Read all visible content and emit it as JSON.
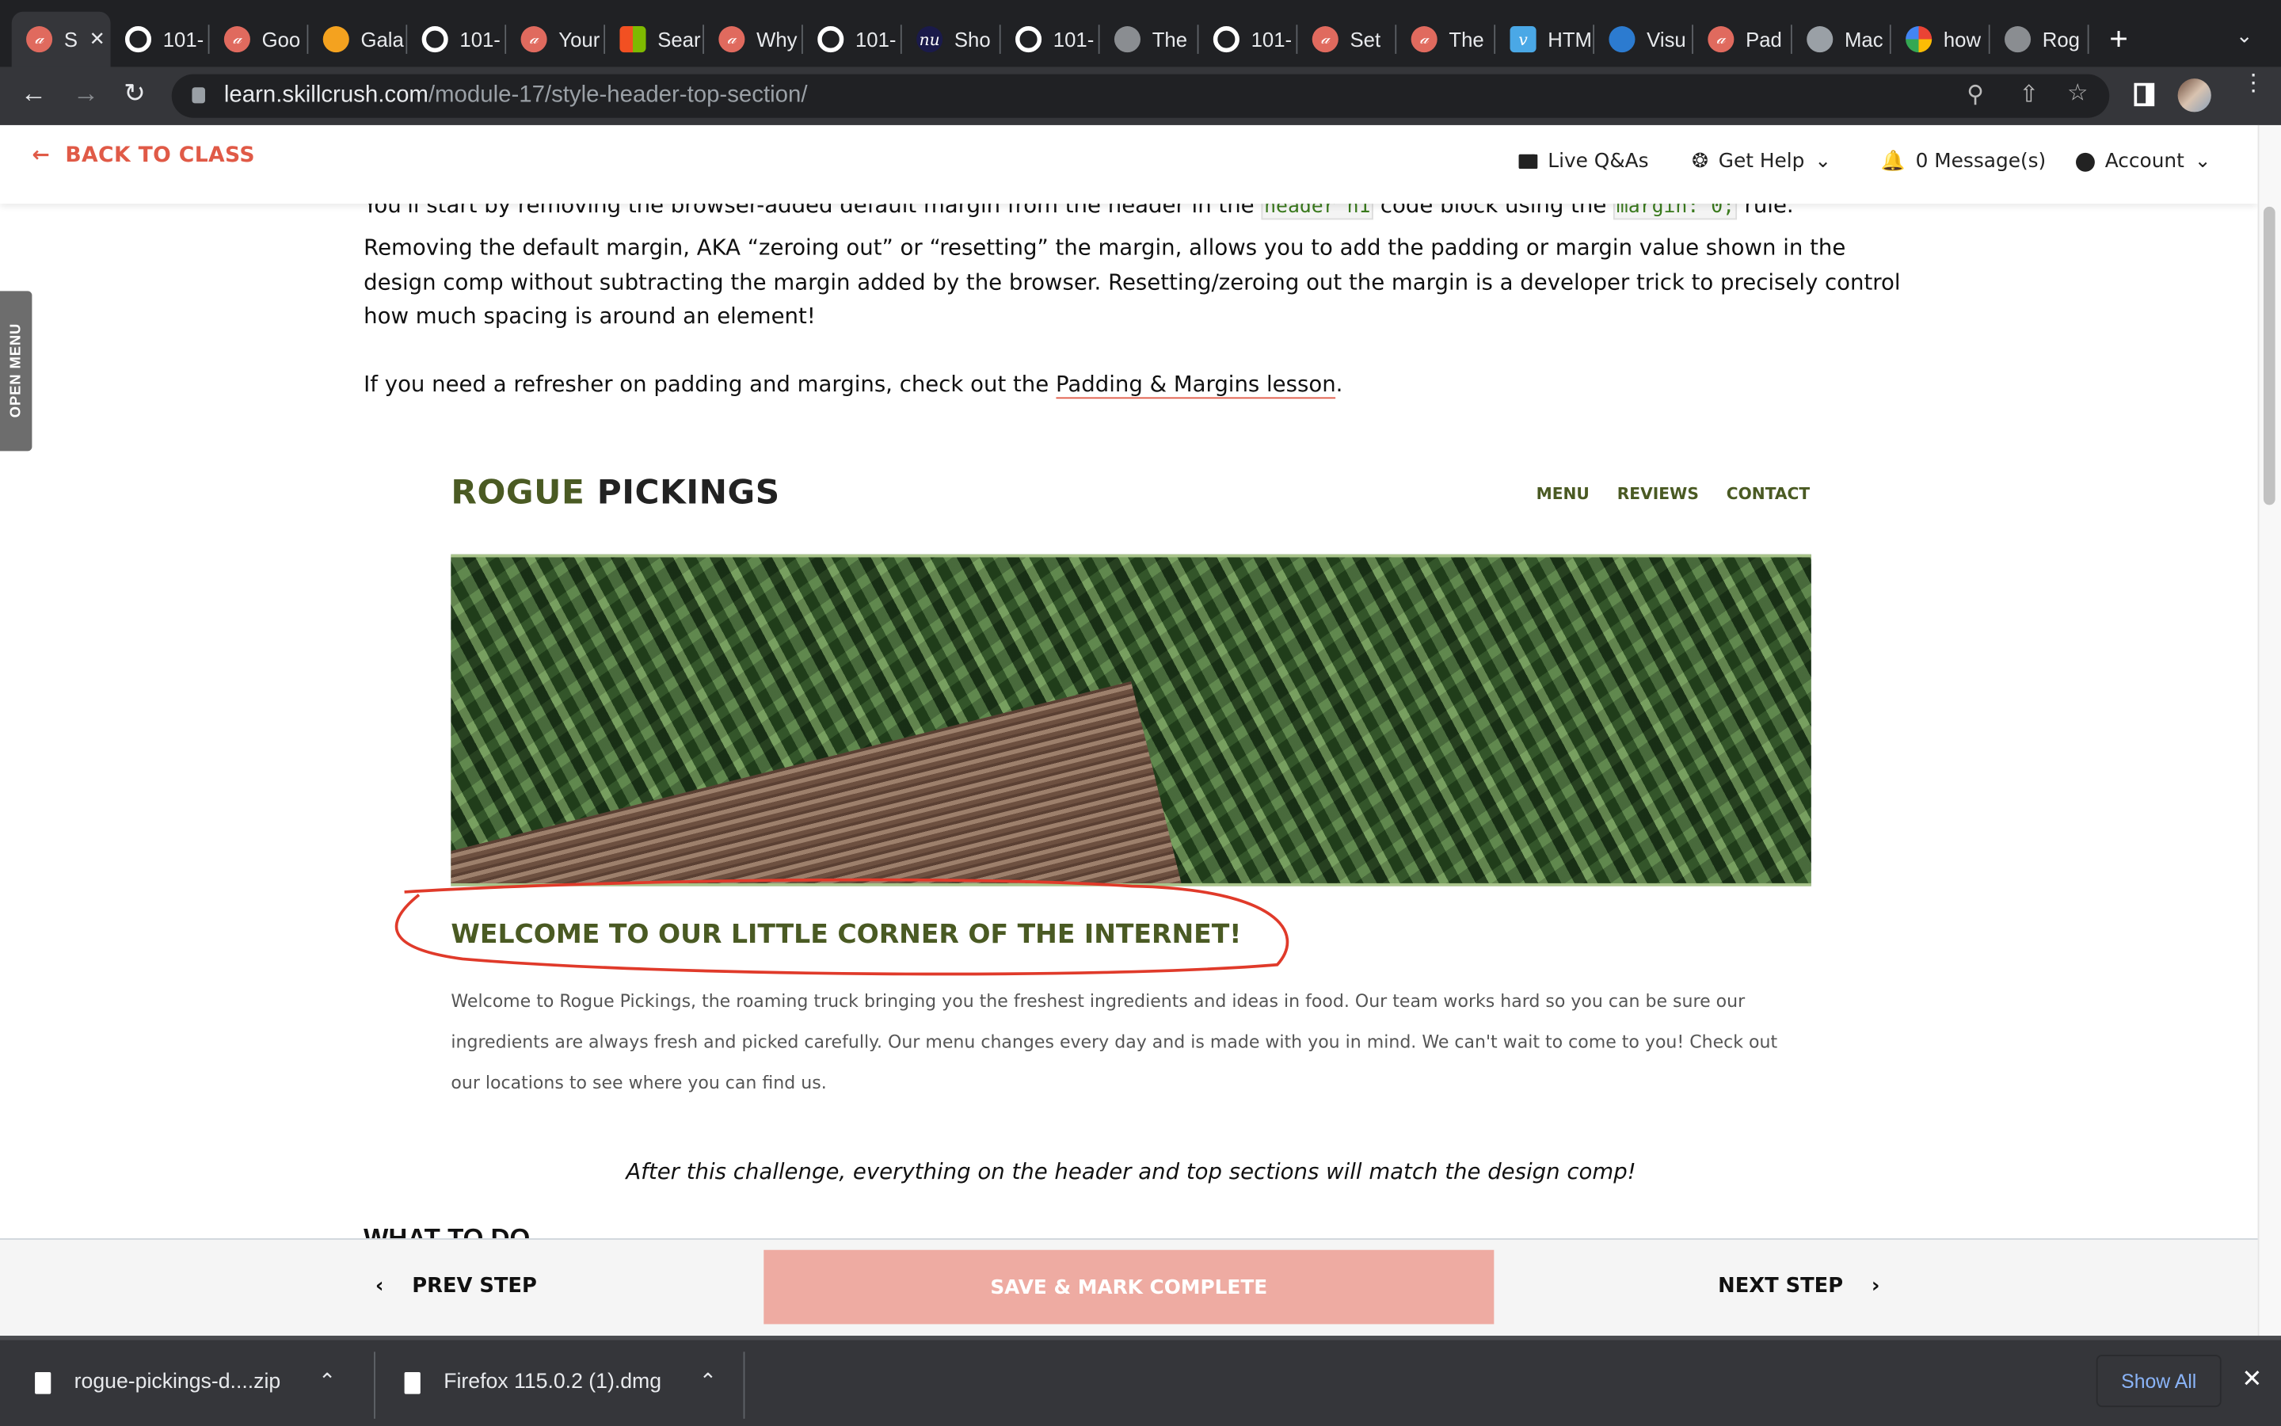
{
  "browser": {
    "tabs": [
      {
        "label": "S",
        "icon": "skillcrush-icon",
        "active": true
      },
      {
        "label": "101-",
        "icon": "github-icon"
      },
      {
        "label": "Goo",
        "icon": "skillcrush-icon"
      },
      {
        "label": "Gala",
        "icon": "galaxy-icon"
      },
      {
        "label": "101-",
        "icon": "github-icon"
      },
      {
        "label": "Your",
        "icon": "skillcrush-icon"
      },
      {
        "label": "Sear",
        "icon": "microsoft-icon"
      },
      {
        "label": "Why",
        "icon": "skillcrush-icon"
      },
      {
        "label": "101-",
        "icon": "github-icon"
      },
      {
        "label": "Sho",
        "icon": "nu-icon"
      },
      {
        "label": "101-",
        "icon": "github-icon"
      },
      {
        "label": "The",
        "icon": "globe-icon"
      },
      {
        "label": "101-",
        "icon": "github-icon"
      },
      {
        "label": "Set",
        "icon": "skillcrush-icon"
      },
      {
        "label": "The",
        "icon": "skillcrush-icon"
      },
      {
        "label": "HTM",
        "icon": "vimeo-icon"
      },
      {
        "label": "Visu",
        "icon": "vscode-icon"
      },
      {
        "label": "Pad",
        "icon": "skillcrush-icon"
      },
      {
        "label": "Mac",
        "icon": "apple-icon"
      },
      {
        "label": "how",
        "icon": "google-icon"
      },
      {
        "label": "Rog",
        "icon": "globe-icon"
      }
    ],
    "url_domain": "learn.skillcrush.com",
    "url_path": "/module-17/style-header-top-section/"
  },
  "site_header": {
    "back": "BACK TO CLASS",
    "live": "Live Q&As",
    "help": "Get Help",
    "messages": "0 Message(s)",
    "account": "Account"
  },
  "side_menu": "OPEN MENU",
  "content": {
    "p1_a": "You'll start by removing the browser-added default margin from the header in the ",
    "p1_code1": "header h1",
    "p1_b": " code block using the ",
    "p1_code2": "margin: 0;",
    "p1_c": " rule.",
    "p2": "Removing the default margin, AKA “zeroing out” or “resetting” the margin, allows you to add the padding or margin value shown in the design comp without subtracting the margin added by the browser. Resetting/zeroing out the margin is a developer trick to precisely control how much spacing is around an element!",
    "p3_a": "If you need a refresher on padding and margins, check out the ",
    "p3_link": "Padding & Margins lesson",
    "p3_b": ".",
    "preview": {
      "logo_a": "ROGUE",
      "logo_b": "PICKINGS",
      "nav": [
        "MENU",
        "REVIEWS",
        "CONTACT"
      ],
      "heading": "WELCOME TO OUR LITTLE CORNER OF THE INTERNET!",
      "body": "Welcome to Rogue Pickings, the roaming truck bringing you the freshest ingredients and ideas in food. Our team works hard so you can be sure our ingredients are always fresh and picked carefully. Our menu changes every day and is made with you in mind. We can't wait to come to you! Check out our locations to see where you can find us."
    },
    "caption": "After this challenge, everything on the header and top sections will match the design comp!",
    "next_heading": "WHAT TO DO"
  },
  "footer": {
    "prev": "PREV STEP",
    "save": "SAVE & MARK COMPLETE",
    "next": "NEXT STEP"
  },
  "downloads": {
    "items": [
      "rogue-pickings-d....zip",
      "Firefox 115.0.2 (1).dmg"
    ],
    "show_all": "Show All"
  },
  "colors": {
    "accent": "#e05a47",
    "save_button": "#eeaba2",
    "logo_green": "#4a5a23"
  }
}
